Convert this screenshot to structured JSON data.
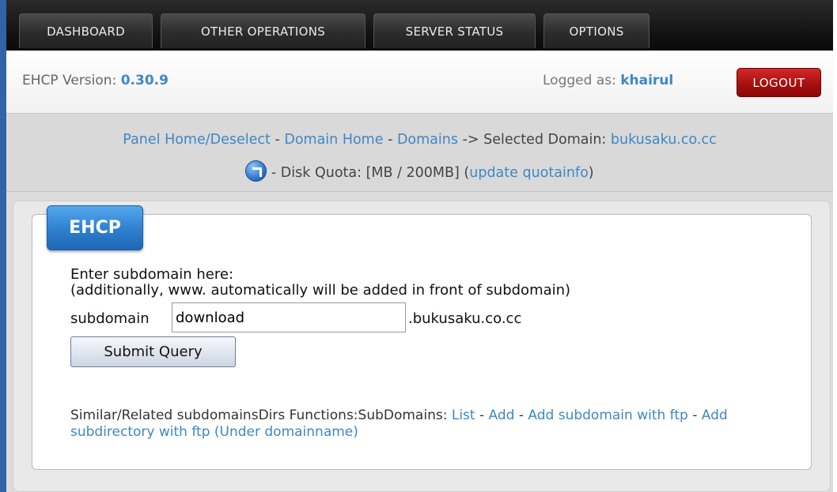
{
  "nav": {
    "items": [
      "DASHBOARD",
      "OTHER OPERATIONS",
      "SERVER STATUS",
      "OPTIONS"
    ]
  },
  "header": {
    "version_label": "EHCP Version:",
    "version_value": "0.30.9",
    "logged_label": "Logged as:",
    "username": "khairul",
    "logout_label": "LOGOUT"
  },
  "breadcrumb": {
    "panel_home": "Panel Home/Deselect",
    "sep1": " - ",
    "domain_home": "Domain Home",
    "sep2": " - ",
    "domains": "Domains",
    "selected_text": " -> Selected Domain: ",
    "selected_domain": "bukusaku.co.cc",
    "quota_text": " - Disk Quota: [MB / 200MB] (",
    "update_quota": "update quotainfo",
    "quota_close": ")"
  },
  "panel": {
    "tag": "EHCP",
    "instruction_1": "Enter subdomain here:",
    "instruction_2": "(additionally, www. automatically will be added in front of subdomain)",
    "subdomain_label": "subdomain",
    "subdomain_value": "download",
    "domain_suffix": ".bukusaku.co.cc",
    "submit_label": "Submit Query",
    "related_prefix": "Similar/Related subdomainsDirs Functions:SubDomains: ",
    "link_list": "List",
    "sep_a": " - ",
    "link_add": "Add",
    "sep_b": " - ",
    "link_add_ftp": "Add subdomain with ftp",
    "sep_c": " - ",
    "link_add_dir": "Add subdirectory with ftp (Under domainname)"
  },
  "colors": {
    "link": "#3f87c5",
    "accent": "#2f64a8",
    "logout": "#a40d0d"
  }
}
